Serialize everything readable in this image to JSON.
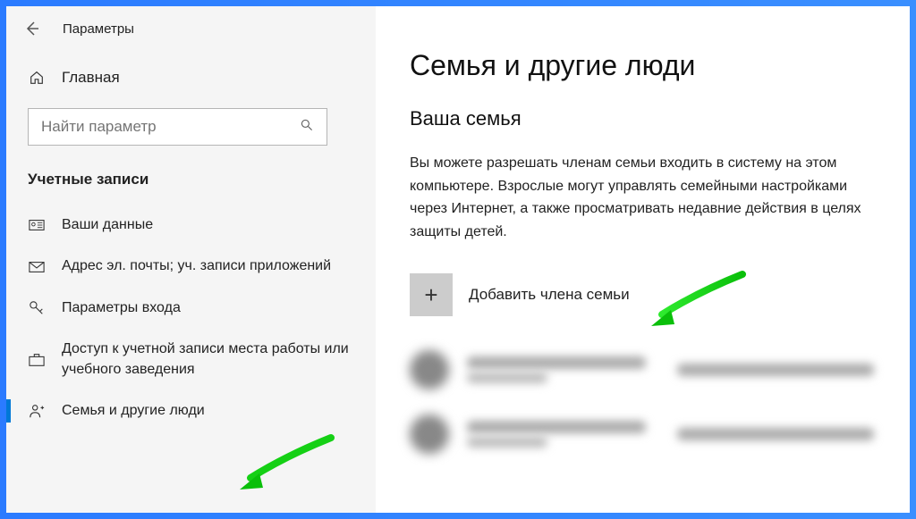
{
  "titlebar": {
    "app_title": "Параметры"
  },
  "sidebar": {
    "home_label": "Главная",
    "search_placeholder": "Найти параметр",
    "category": "Учетные записи",
    "items": [
      {
        "label": "Ваши данные"
      },
      {
        "label": "Адрес эл. почты; уч. записи приложений"
      },
      {
        "label": "Параметры входа"
      },
      {
        "label": "Доступ к учетной записи места работы или учебного заведения"
      },
      {
        "label": "Семья и другие люди"
      }
    ]
  },
  "main": {
    "page_heading": "Семья и другие люди",
    "section_heading": "Ваша семья",
    "section_desc": "Вы можете разрешать членам семьи входить в систему на этом компьютере. Взрослые могут управлять семейными настройками через Интернет, а также просматривать недавние действия в целях защиты детей.",
    "add_label": "Добавить члена семьи"
  }
}
